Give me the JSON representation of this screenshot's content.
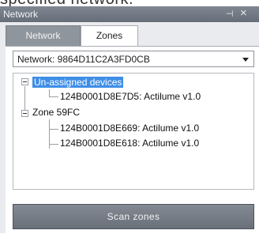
{
  "caption": "specified network.",
  "window": {
    "title": "Network",
    "pin_glyph": "⊣",
    "close_glyph": "×"
  },
  "tabs": [
    {
      "label": "Network",
      "active": false
    },
    {
      "label": "Zones",
      "active": true
    }
  ],
  "network_select": {
    "value": "Network: 9864D11C2A3FD0CB"
  },
  "tree": {
    "groups": [
      {
        "label": "Un-assigned devices",
        "selected": true,
        "expanded": true,
        "children": [
          "124B0001D8E7D5: Actilume v1.0"
        ]
      },
      {
        "label": "Zone 59FC",
        "selected": false,
        "expanded": true,
        "children": [
          "124B0001D8E669: Actilume v1.0",
          "124B0001D8E618: Actilume v1.0"
        ]
      }
    ]
  },
  "actions": {
    "scan_label": "Scan zones"
  },
  "colors": {
    "selection": "#3f8ee6",
    "titlebar": "#6f7681",
    "button": "#767c85"
  }
}
